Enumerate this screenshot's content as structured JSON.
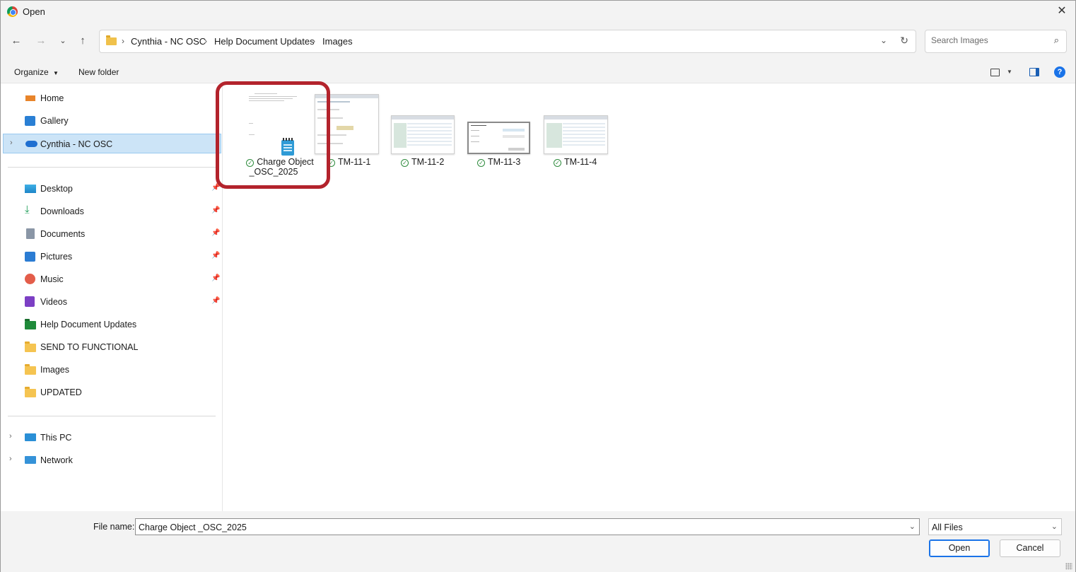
{
  "window": {
    "title": "Open"
  },
  "address": {
    "crumbs": [
      "Cynthia - NC OSC",
      "Help Document Updates",
      "Images"
    ]
  },
  "search": {
    "placeholder": "Search Images"
  },
  "toolbar": {
    "organize": "Organize",
    "new_folder": "New folder"
  },
  "sidebar": {
    "top": [
      {
        "label": "Home",
        "icon": "home-icon"
      },
      {
        "label": "Gallery",
        "icon": "gallery-icon"
      },
      {
        "label": "Cynthia - NC OSC",
        "icon": "onedrive-cloud-icon",
        "selected": true
      }
    ],
    "quick": [
      {
        "label": "Desktop",
        "icon": "desktop-icon",
        "pinned": true
      },
      {
        "label": "Downloads",
        "icon": "downloads-icon",
        "pinned": true
      },
      {
        "label": "Documents",
        "icon": "documents-icon",
        "pinned": true
      },
      {
        "label": "Pictures",
        "icon": "pictures-icon",
        "pinned": true
      },
      {
        "label": "Music",
        "icon": "music-icon",
        "pinned": true
      },
      {
        "label": "Videos",
        "icon": "videos-icon",
        "pinned": true
      },
      {
        "label": "Help Document Updates",
        "icon": "folder-green-icon"
      },
      {
        "label": "SEND TO FUNCTIONAL",
        "icon": "folder-icon"
      },
      {
        "label": "Images",
        "icon": "folder-icon"
      },
      {
        "label": "UPDATED",
        "icon": "folder-icon"
      }
    ],
    "bottom": [
      {
        "label": "This PC",
        "icon": "this-pc-icon"
      },
      {
        "label": "Network",
        "icon": "network-icon"
      }
    ]
  },
  "files": [
    {
      "name_line1": "Charge Object",
      "name_line2": "_OSC_2025",
      "type": "text-document",
      "highlighted": true
    },
    {
      "name_line1": "TM-11-1",
      "type": "image"
    },
    {
      "name_line1": "TM-11-2",
      "type": "image"
    },
    {
      "name_line1": "TM-11-3",
      "type": "image"
    },
    {
      "name_line1": "TM-11-4",
      "type": "image"
    }
  ],
  "footer": {
    "file_name_label": "File name:",
    "file_name_value": "Charge Object _OSC_2025",
    "file_type": "All Files",
    "open_label": "Open",
    "cancel_label": "Cancel"
  },
  "colors": {
    "accent": "#1a73e8",
    "selected_bg": "#cce4f7",
    "highlight_border": "#b3232c",
    "sync_ok": "#2e8b3d"
  }
}
